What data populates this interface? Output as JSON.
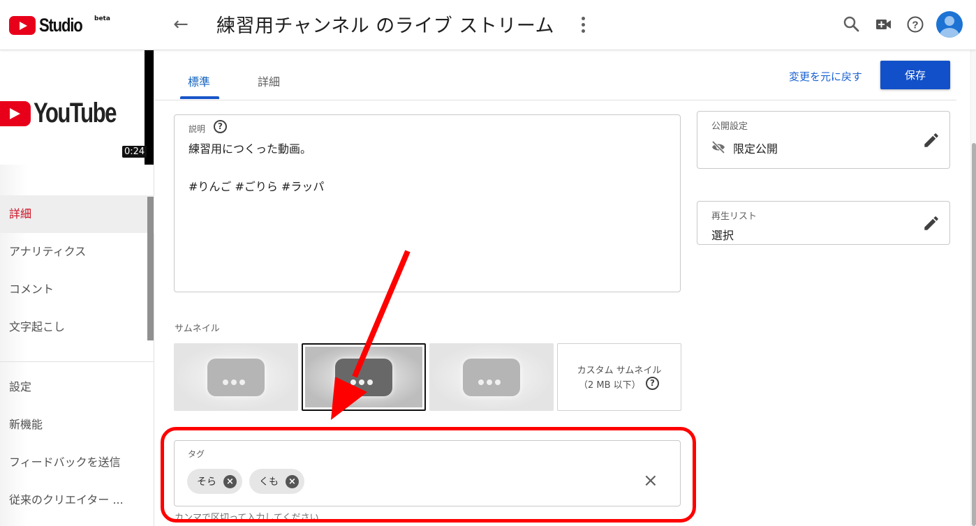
{
  "header": {
    "logo_text": "Studio",
    "logo_badge": "beta",
    "back_icon": "←",
    "title": "練習用チャンネル のライブ ストリーム",
    "icons": [
      "search-icon",
      "create-video-icon",
      "help-icon",
      "account-avatar"
    ]
  },
  "sidebar": {
    "video_logo_text": "YouTube",
    "duration": "0:24",
    "items": [
      {
        "label": "詳細",
        "active": true
      },
      {
        "label": "アナリティクス",
        "active": false
      },
      {
        "label": "コメント",
        "active": false
      },
      {
        "label": "文字起こし",
        "active": false
      }
    ],
    "bottom_items": [
      {
        "label": "設定"
      },
      {
        "label": "新機能"
      },
      {
        "label": "フィードバックを送信"
      },
      {
        "label": "従来のクリエイター ..."
      }
    ]
  },
  "tabs": [
    {
      "label": "標準",
      "active": true
    },
    {
      "label": "詳細",
      "active": false
    }
  ],
  "actions": {
    "undo_label": "変更を元に戻す",
    "save_label": "保存"
  },
  "description": {
    "label": "説明",
    "help": "?",
    "value": "練習用につくった動画。\n\n#りんご #ごりら #ラッパ"
  },
  "visibility": {
    "label": "公開設定",
    "value": "限定公開",
    "icon": "eye-off-icon"
  },
  "playlist": {
    "label": "再生リスト",
    "value": "選択"
  },
  "thumbnails": {
    "label": "サムネイル",
    "selected_index": 1,
    "custom_line1": "カスタム サムネイル",
    "custom_line2": "（2 MB 以下）",
    "custom_help": "?"
  },
  "tags": {
    "label": "タグ",
    "chips": [
      {
        "label": "そら"
      },
      {
        "label": "くも"
      }
    ],
    "clear_icon": "×",
    "hint": "カンマで区切って入力してください"
  },
  "annotation": {
    "color": "#ff0000"
  },
  "colors": {
    "accent": "#1250c9",
    "active_nav": "#cc0f22",
    "brand_red": "#e8001b"
  }
}
